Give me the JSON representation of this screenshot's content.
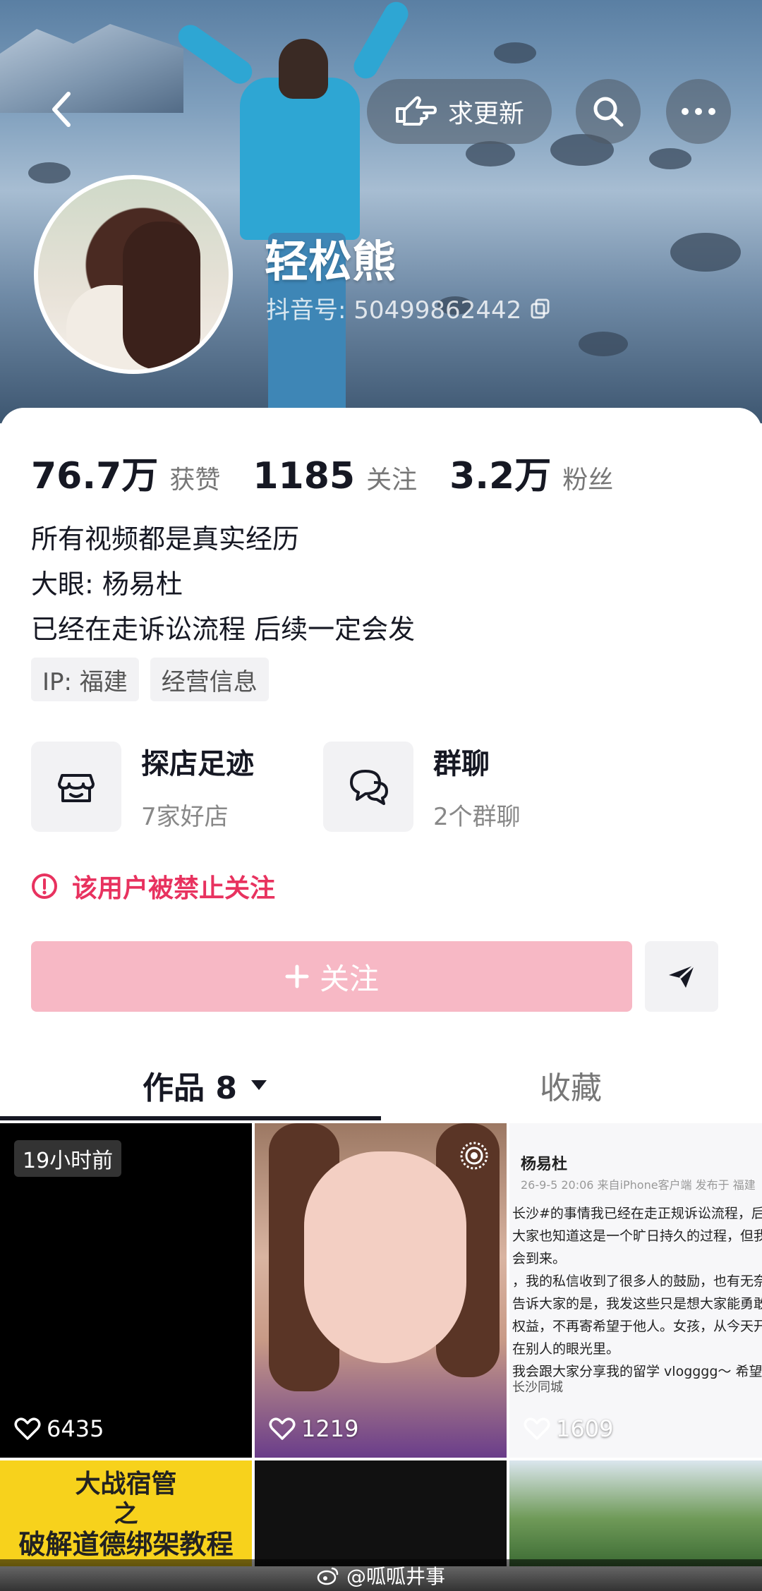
{
  "header": {
    "update_label": "求更新",
    "username": "轻松熊",
    "douyin_id": "抖音号: 50499862442"
  },
  "stats": [
    {
      "value": "76.7万",
      "label": "获赞"
    },
    {
      "value": "1185",
      "label": "关注"
    },
    {
      "value": "3.2万",
      "label": "粉丝"
    }
  ],
  "bio": [
    "所有视频都是真实经历",
    "大眼: 杨易杜",
    "已经在走诉讼流程 后续一定会发"
  ],
  "tags": [
    "IP: 福建",
    "经营信息"
  ],
  "features": {
    "shop": {
      "title": "探店足迹",
      "subtitle": "7家好店",
      "icon": "shop-icon"
    },
    "group": {
      "title": "群聊",
      "subtitle": "2个群聊",
      "icon": "chat-icon"
    }
  },
  "ban_notice": "该用户被禁止关注",
  "follow_label": "关注",
  "tabs": {
    "works": "作品 8",
    "favorites": "收藏"
  },
  "grid": {
    "items": [
      {
        "badge": "19小时前",
        "likes": "6435"
      },
      {
        "likes": "1219"
      },
      {
        "likes": "1609"
      }
    ],
    "post_preview": {
      "author": "杨易杜",
      "meta": "26-9-5 20:06 来自iPhone客户端 发布于 福建",
      "lines": [
        "长沙#的事情我已经在走正规诉讼流程，后续一定会",
        "大家也知道这是一个旷日持久的过程，但我相信正",
        "会到来。",
        "，我的私信收到了很多人的鼓励，也有无奈和共鸣",
        "告诉大家的是，我发这些只是想大家能勇敢地争取",
        "权益，不再寄希望于他人。女孩，从今天开始，不",
        "在别人的眼光里。",
        "我会跟大家分享我的留学 vlogggg～ 希望大家天天"
      ],
      "location": "长沙同城"
    },
    "cover_text": [
      "大战宿管",
      "之",
      "破解道德绑架教程"
    ]
  },
  "watermark": "@呱呱井事",
  "colors": {
    "accent_pink": "#f7b8c5",
    "warning_red": "#e8325f"
  }
}
